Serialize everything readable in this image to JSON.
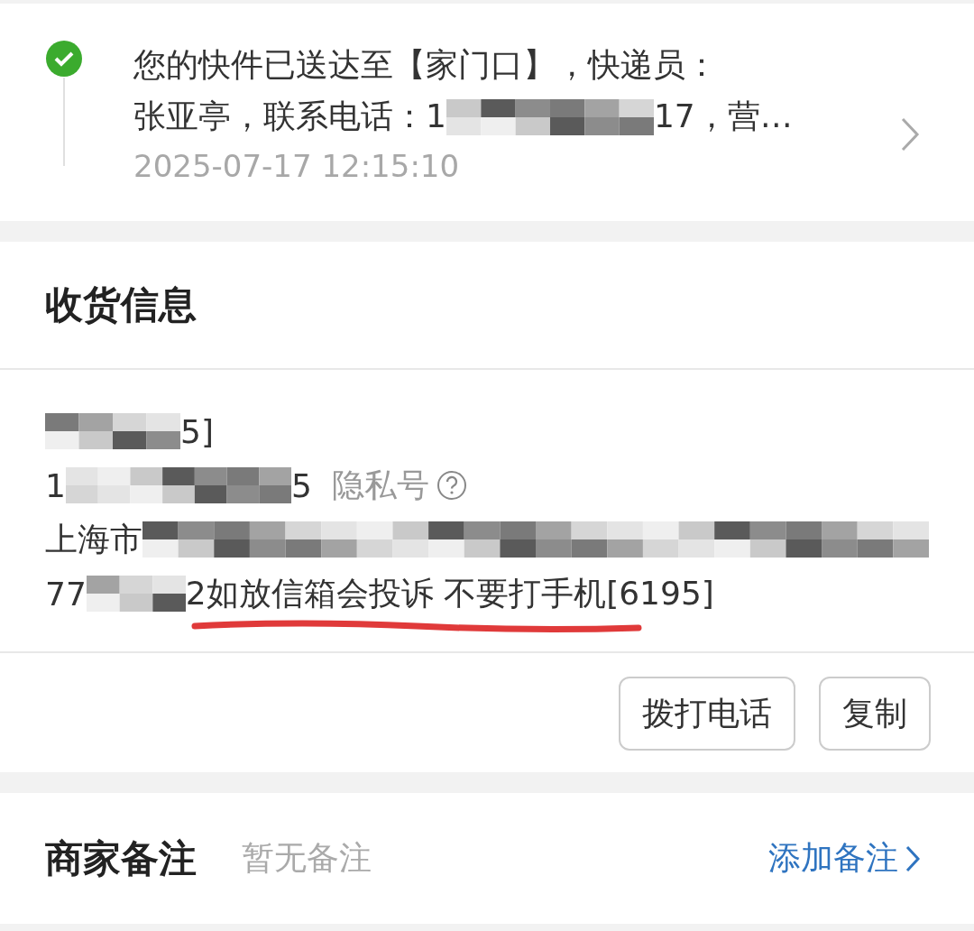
{
  "tracking": {
    "delivered": true,
    "lines": [
      [
        {
          "kind": "text",
          "text": "您的快件已送达至【家门口】，快递员："
        }
      ],
      [
        {
          "kind": "text",
          "text": "张亚亭，联系电话：1"
        },
        {
          "kind": "mosaic"
        },
        {
          "kind": "text",
          "text": "17，营…"
        }
      ]
    ],
    "time": "2025-07-17 12:15:10"
  },
  "receiver": {
    "title": "收货信息",
    "lines": [
      [
        {
          "kind": "mosaic"
        },
        {
          "kind": "text",
          "text": "5]"
        }
      ],
      [
        {
          "kind": "text",
          "text": "1"
        },
        {
          "kind": "mosaic"
        },
        {
          "kind": "text",
          "text": "5"
        },
        {
          "kind": "privacy",
          "text": "隐私号"
        }
      ],
      [
        {
          "kind": "text",
          "text": "上海市"
        },
        {
          "kind": "mosaic"
        }
      ],
      [
        {
          "kind": "text",
          "text": "77"
        },
        {
          "kind": "mosaic"
        },
        {
          "kind": "text",
          "text": "2如放信箱会投诉 不要打手机[6195]",
          "underlined": true
        }
      ]
    ],
    "buttons": [
      "拨打电话",
      "复制"
    ]
  },
  "note": {
    "label": "商家备注",
    "value": "暂无备注",
    "action": "添加备注"
  }
}
